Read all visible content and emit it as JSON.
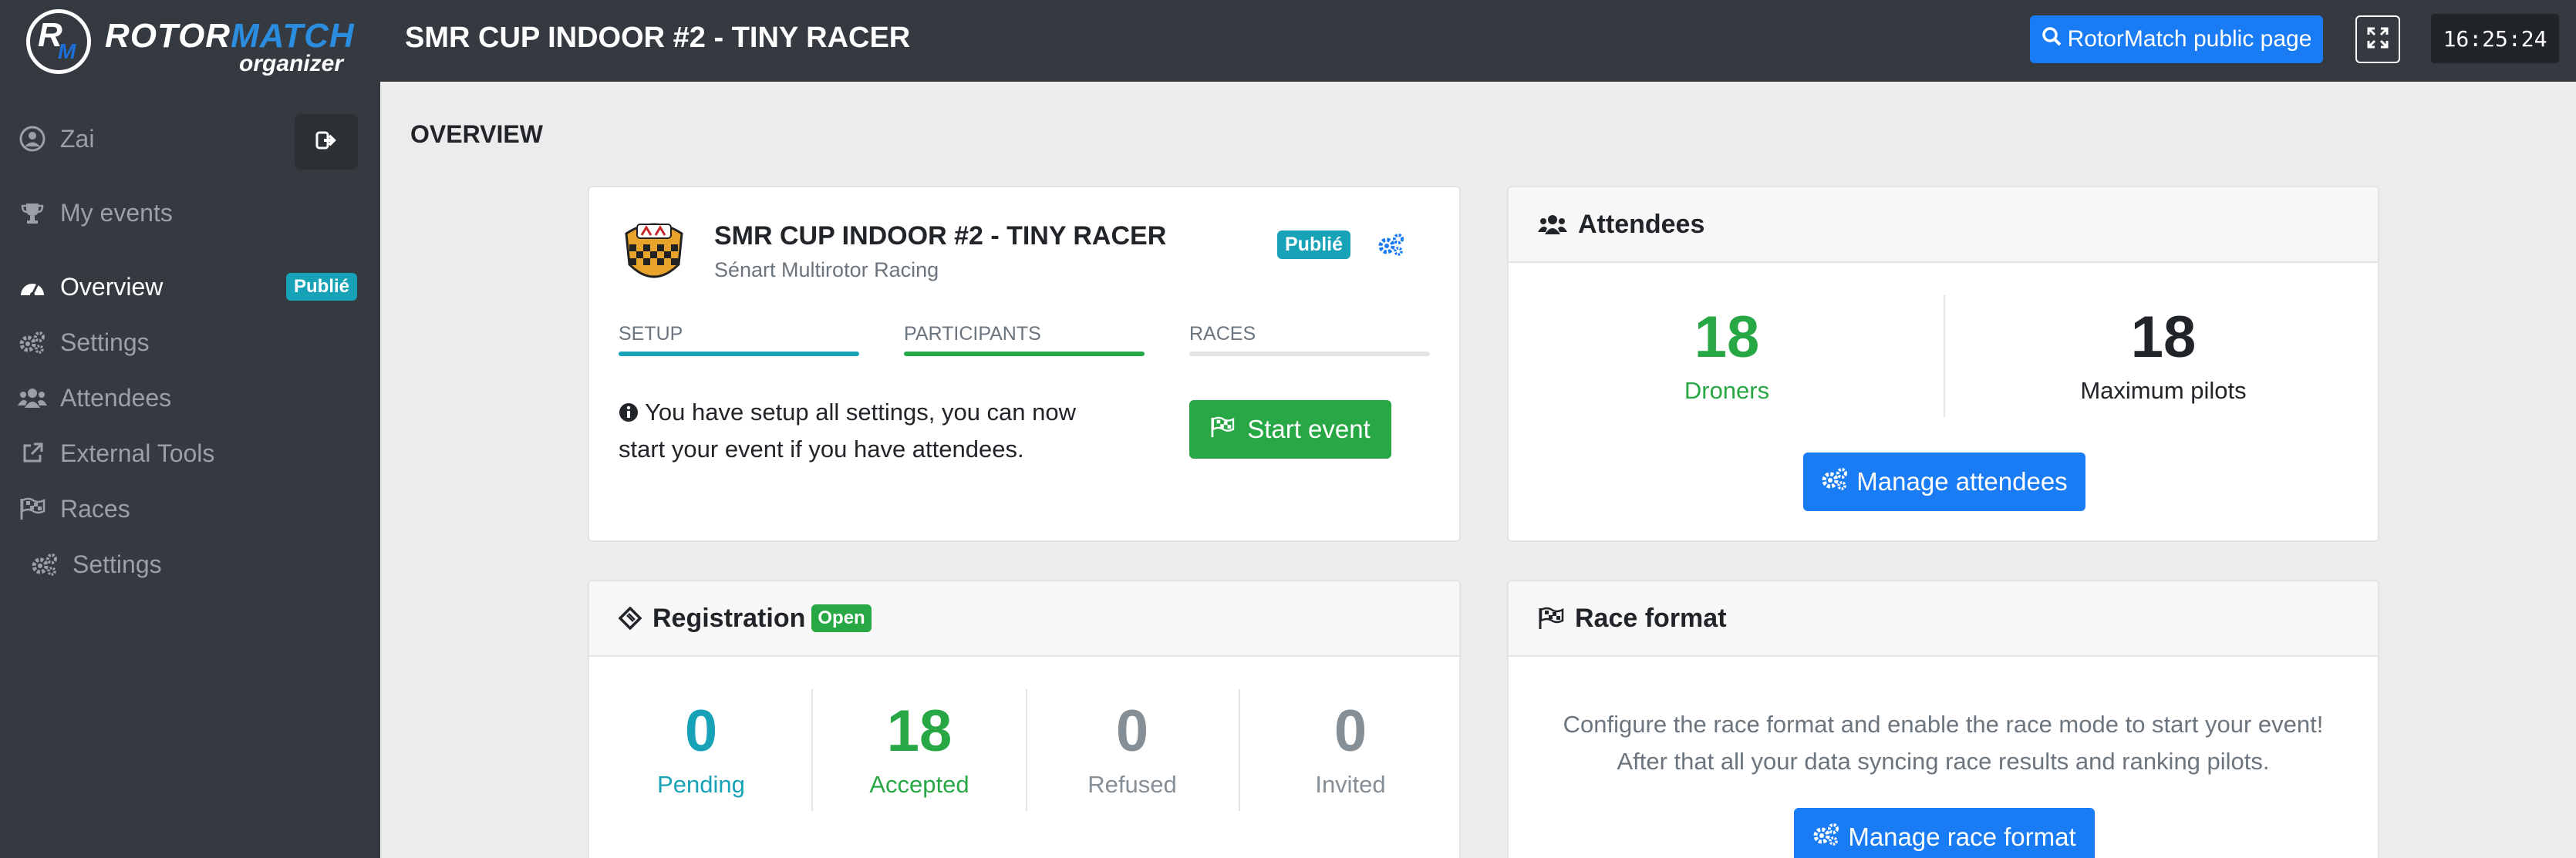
{
  "brand": {
    "word1": "ROTOR",
    "word2": "MATCH",
    "sub": "organizer",
    "mark_r": "R",
    "mark_m": "M"
  },
  "user": {
    "name": "Zai"
  },
  "sidebar": {
    "items": [
      {
        "label": "My events",
        "icon": "trophy-icon"
      },
      {
        "label": "Overview",
        "icon": "dashboard-icon",
        "badge": "Publié"
      },
      {
        "label": "Settings",
        "icon": "gears-icon"
      },
      {
        "label": "Attendees",
        "icon": "users-icon"
      },
      {
        "label": "External Tools",
        "icon": "external-link-icon"
      },
      {
        "label": "Races",
        "icon": "flag-checkered-icon"
      },
      {
        "label": "Settings",
        "icon": "gears-icon"
      }
    ]
  },
  "topbar": {
    "title": "SMR CUP INDOOR #2 - TINY RACER",
    "public_button": "RotorMatch public page",
    "clock": "16:25:24"
  },
  "main": {
    "section_title": "OVERVIEW",
    "event_card": {
      "name": "SMR CUP INDOOR #2 - TINY RACER",
      "organizer": "Sénart Multirotor Racing",
      "status_badge": "Publié",
      "steps": [
        {
          "label": "SETUP",
          "color": "#17a2b8",
          "done": true
        },
        {
          "label": "PARTICIPANTS",
          "color": "#28a745",
          "done": true
        },
        {
          "label": "RACES",
          "color": "#e3e3e3",
          "done": false
        }
      ],
      "info_line1": "You have setup all settings, you can now",
      "info_line2": "start your event if you have attendees.",
      "start_button": "Start event"
    },
    "attendees_card": {
      "title": "Attendees",
      "droners_value": "18",
      "droners_label": "Droners",
      "max_value": "18",
      "max_label": "Maximum pilots",
      "manage_button": "Manage attendees"
    },
    "registration_card": {
      "title": "Registration",
      "badge": "Open",
      "stats": [
        {
          "value": "0",
          "label": "Pending",
          "color": "#17a2b8"
        },
        {
          "value": "18",
          "label": "Accepted",
          "color": "#28a745"
        },
        {
          "value": "0",
          "label": "Refused",
          "color": "#868e96"
        },
        {
          "value": "0",
          "label": "Invited",
          "color": "#868e96"
        }
      ]
    },
    "race_format_card": {
      "title": "Race format",
      "line1": "Configure the race format and enable the race mode to start your event!",
      "line2": "After that all your data syncing race results and ranking pilots.",
      "manage_button": "Manage race format"
    }
  },
  "colors": {
    "sidebar_bg": "#343a40",
    "primary": "#1a7cf4",
    "success": "#28a745",
    "info": "#17a2b8"
  }
}
